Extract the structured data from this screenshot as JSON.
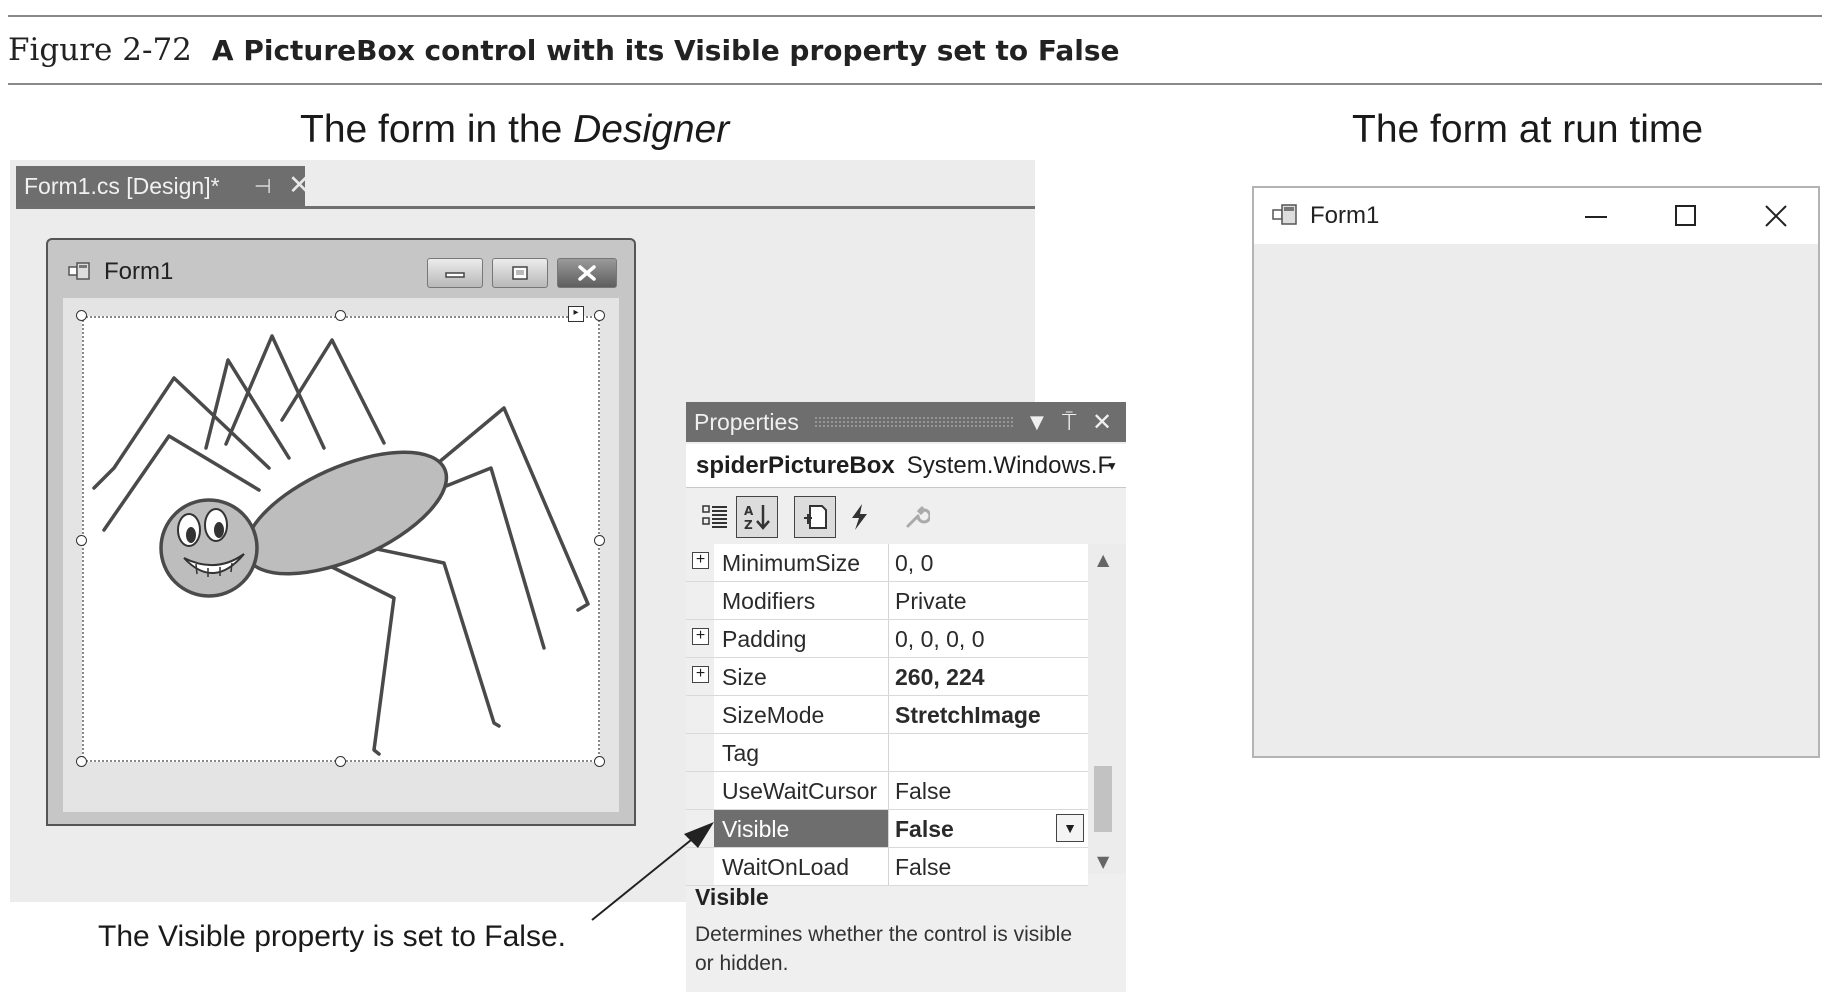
{
  "figure": {
    "number": "Figure 2-72",
    "title": "A PictureBox control with its Visible property set to False"
  },
  "headings": {
    "designer_prefix": "The form in the ",
    "designer_emphasis": "Designer",
    "runtime": "The form at run time"
  },
  "designer": {
    "tab_label": "Form1.cs [Design]*",
    "tab_pin_icon": "pin-icon",
    "tab_close_icon": "close-icon",
    "form_title": "Form1",
    "picturebox_image": "spider-image"
  },
  "properties": {
    "window_title": "Properties",
    "object_name": "spiderPictureBox",
    "object_type": "System.Windows.F",
    "toolbar_icons": [
      "categorized-icon",
      "alphabetical-icon",
      "properties-icon",
      "events-icon",
      "property-pages-icon"
    ],
    "rows": [
      {
        "name": "MinimumSize",
        "value": "0, 0",
        "expandable": true
      },
      {
        "name": "Modifiers",
        "value": "Private",
        "expandable": false
      },
      {
        "name": "Padding",
        "value": "0, 0, 0, 0",
        "expandable": true
      },
      {
        "name": "Size",
        "value": "260, 224",
        "expandable": true
      },
      {
        "name": "SizeMode",
        "value": "StretchImage",
        "expandable": false
      },
      {
        "name": "Tag",
        "value": "",
        "expandable": false
      },
      {
        "name": "UseWaitCursor",
        "value": "False",
        "expandable": false
      },
      {
        "name": "Visible",
        "value": "False",
        "expandable": false,
        "selected": true
      },
      {
        "name": "WaitOnLoad",
        "value": "False",
        "expandable": false
      }
    ],
    "description_title": "Visible",
    "description_text": "Determines whether the control is visible or hidden."
  },
  "callout": "The Visible property is set to False.",
  "runtime_form": {
    "title": "Form1"
  }
}
